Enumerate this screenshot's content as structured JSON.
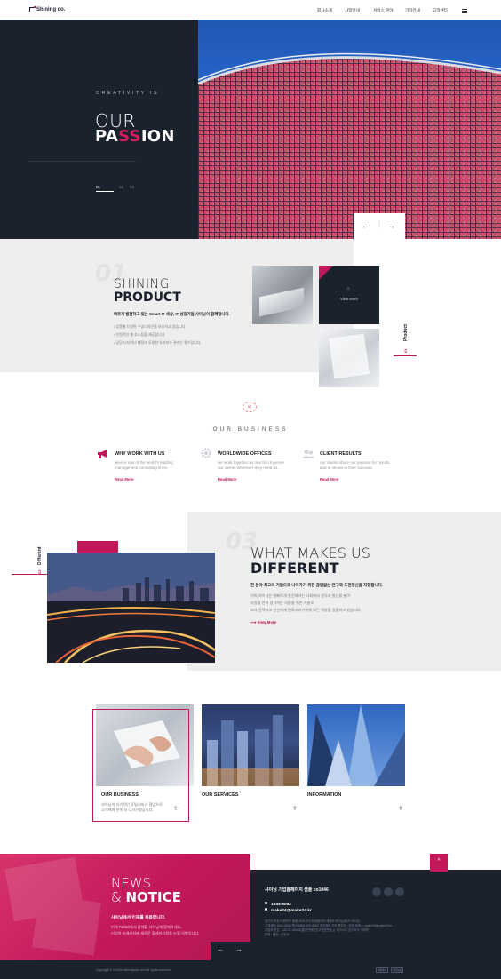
{
  "header": {
    "logo": "Shining co.",
    "nav": [
      "회사소개",
      "사업안내",
      "서비스 분야",
      "기타안내",
      "고객센터"
    ]
  },
  "hero": {
    "kicker": "CREATIVITY IS",
    "title_line1": "OUR",
    "title_line2_a": "PA",
    "title_line2_b": "SS",
    "title_line2_c": "ION",
    "pages": [
      "01",
      "02",
      "03"
    ],
    "prev": "←",
    "next": "→"
  },
  "product": {
    "num": "01",
    "title1": "SHINING",
    "title2": "PRODUCT",
    "desc": "빠르게 발전하고 있는 Smart IT 세상, IT 성장기업 샤이닝이 함께합니다.",
    "list": [
      "• 업종별 다양한 우공디자인을 보유하고 있습니다.",
      "• 안정적인 웹 호스팅을 제공합니다.",
      "• 담당 디자이너 배정과 투명한 유지보수 관리는 필수입니다."
    ],
    "view_more": "View More",
    "plus": "+",
    "side_label": "Product",
    "side_num": "01"
  },
  "business": {
    "badge": "02",
    "heading": "OUR BUSINESS",
    "items": [
      {
        "title": "WHY WORK WITH US",
        "desc": "wise is one of the world's leading management consulting firms.",
        "link": "Read More"
      },
      {
        "title": "WORLDWIDE OFFICES",
        "desc": "we work together as one firm to serve our clients wherever they need us.",
        "link": "Read More"
      },
      {
        "title": "CLIENT RESULTS",
        "desc": "our clients share our passion for results and in shows in their success.",
        "link": "Read More"
      }
    ]
  },
  "different": {
    "num": "03",
    "title1": "WHAT MAKES US",
    "title2": "DIFFERENT",
    "desc": "한 분야 최고의 기업으로 나아가기 위한 끊임없는 연구와 도전정신을 지향합니다.",
    "lines": [
      "저희 샤이닝은 발빠르게 발전해가는 사회에서 생각과 발상을 늘어",
      "사람을 먼저 생각하는 사람을 위한 기술로",
      "보다 윤택하고 신선하게 변화시키기위해 모든 역량을 집중하고 있습니다."
    ],
    "view_more": "View More",
    "side_label": "Different",
    "side_num": "03"
  },
  "cards": [
    {
      "title": "OUR BUSINESS",
      "desc": [
        "샤이닝의 유기적인 토털서비스 협업으로",
        "고객에게 만족 더 다가가겠습니다."
      ],
      "plus": "+"
    },
    {
      "title": "OUR SERVICES",
      "desc": [],
      "plus": "+"
    },
    {
      "title": "INFORMATION",
      "desc": [],
      "plus": "+"
    }
  ],
  "news": {
    "title1": "NEWS",
    "title2a": "& ",
    "title2b": "NOTICE",
    "desc": "샤이닝에서 인재를 채용합니다.",
    "lines": [
      "미래 Rabbit에서 함께할 샤이닝께 함께하세요.",
      "기업의 미래가치에 새로운 플레이지원을 드릴 의향입니다."
    ],
    "prev": "←",
    "next": "→"
  },
  "footer": {
    "top": "^",
    "title": "샤이닝 기업홈페이지 샘플 co1046",
    "phone": "1544-6062",
    "email": "make24@make24.kr",
    "info": [
      "경기도 부천시 원미구 중동 1151 오뚜르센텀이터 제테크 바이닝(테크 402호)",
      "고객센터:1544-0834 팩스:0505-300-6062 개인정보 관리 책임자 : 방문 부에스 make24@make24.kr",
      "사업자 번호 : 130-37-56534(통신판매업신고번호번호.)|: 에이스디 호기카이 이마루",
      "운영 : 대표 : 인공서"
    ],
    "copyright": "Copyright © co1046.shiningcorp.com All rights reserved",
    "btns": [
      "이용약관",
      "개인정보"
    ]
  }
}
